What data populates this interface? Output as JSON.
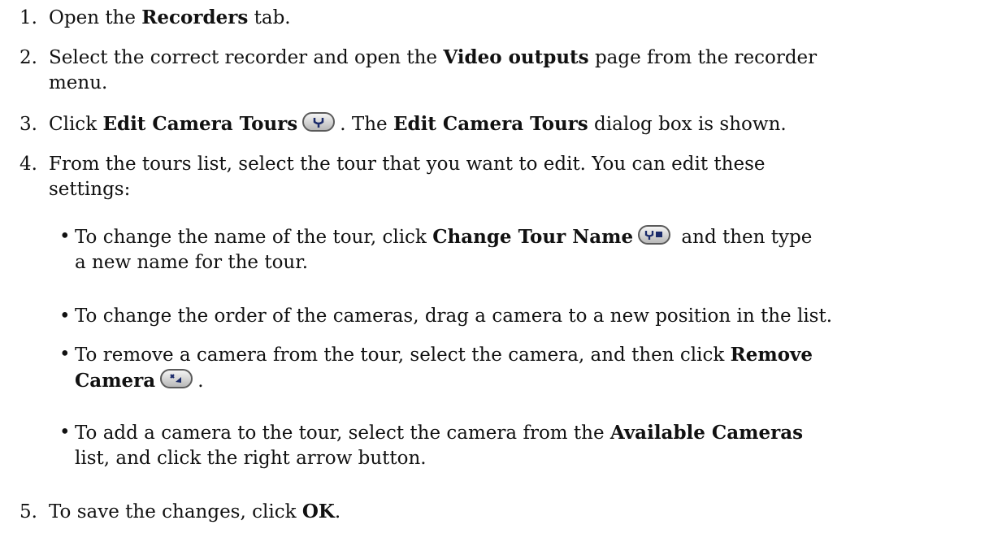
{
  "steps": [
    {
      "num": "1.",
      "pre": "Open the ",
      "b1": "Recorders",
      "post": " tab."
    },
    {
      "num": "2.",
      "pre": "Select the correct recorder and open the ",
      "b1": "Video outputs",
      "post": " page from the recorder",
      "cont": "menu."
    },
    {
      "num": "3.",
      "pre": "Click ",
      "b1": "Edit Camera Tours",
      "mid": ". The ",
      "b2": "Edit Camera Tours",
      "post": " dialog box is shown."
    },
    {
      "num": "4.",
      "pre": "From the tours list, select the tour that you want to edit. You can edit these",
      "cont": "settings:"
    },
    {
      "num": "5.",
      "pre": "To save the changes, click ",
      "b1": "OK",
      "post": "."
    }
  ],
  "bullets": [
    {
      "pre": "To change the name of the tour, click ",
      "b1": "Change Tour Name",
      "post": " and then type",
      "cont": "a new name for the tour."
    },
    {
      "pre": "To change the order of the cameras, drag a camera to a new position in the list."
    },
    {
      "pre": "To remove a camera from the tour, select the camera, and then click ",
      "b1": "Remove",
      "b2": "Camera",
      "post": "."
    },
    {
      "pre": "To add a camera to the tour, select the camera from the ",
      "b1": "Available Cameras",
      "cont": "list, and click the right arrow button."
    }
  ],
  "icons": {
    "edit_tours": "edit-camera-tours-icon",
    "change_name": "change-tour-name-icon",
    "remove_camera": "remove-camera-icon"
  }
}
